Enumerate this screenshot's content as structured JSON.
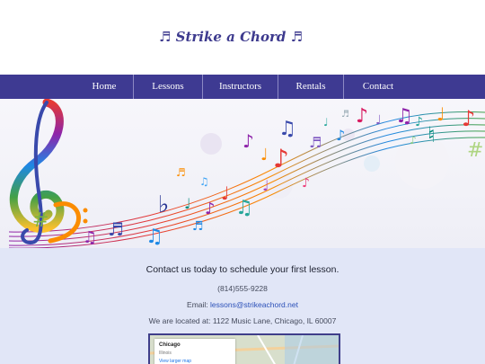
{
  "header": {
    "title": "♬ Strike a Chord ♬"
  },
  "nav": {
    "items": [
      "Home",
      "Lessons",
      "Instructors",
      "Rentals",
      "Contact"
    ]
  },
  "contact": {
    "heading": "Contact us today to schedule your first lesson.",
    "phone": "(814)555-9228",
    "email_prefix": "Email: ",
    "email": "lessons@strikeachord.net",
    "address": "We are located at: 1122 Music Lane, Chicago, IL 60007"
  },
  "map": {
    "city": "Chicago",
    "state": "Illinois",
    "link": "View larger map"
  },
  "colors": {
    "brand": "#3e3a92",
    "contact_bg": "#e1e6f7",
    "link": "#2b50b8"
  }
}
